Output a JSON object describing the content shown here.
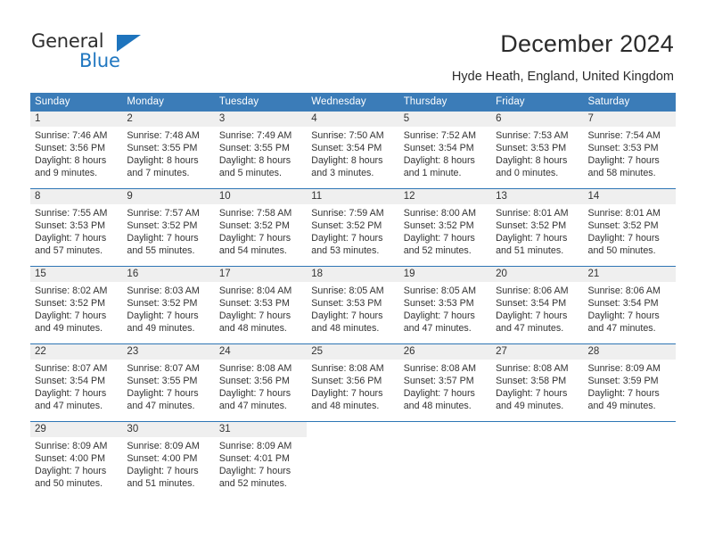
{
  "brand": {
    "name_top": "General",
    "name_bottom": "Blue",
    "accent_color": "#1e74bd",
    "triangle_icon": "triangle-icon"
  },
  "header": {
    "title": "December 2024",
    "subtitle": "Hyde Heath, England, United Kingdom"
  },
  "calendar": {
    "header_bg": "#3b7cb8",
    "row_border_color": "#2e76b5",
    "daynum_bg": "#efefef",
    "weekdays": [
      "Sunday",
      "Monday",
      "Tuesday",
      "Wednesday",
      "Thursday",
      "Friday",
      "Saturday"
    ],
    "weeks": [
      [
        {
          "day": "1",
          "lines": [
            "Sunrise: 7:46 AM",
            "Sunset: 3:56 PM",
            "Daylight: 8 hours",
            "and 9 minutes."
          ]
        },
        {
          "day": "2",
          "lines": [
            "Sunrise: 7:48 AM",
            "Sunset: 3:55 PM",
            "Daylight: 8 hours",
            "and 7 minutes."
          ]
        },
        {
          "day": "3",
          "lines": [
            "Sunrise: 7:49 AM",
            "Sunset: 3:55 PM",
            "Daylight: 8 hours",
            "and 5 minutes."
          ]
        },
        {
          "day": "4",
          "lines": [
            "Sunrise: 7:50 AM",
            "Sunset: 3:54 PM",
            "Daylight: 8 hours",
            "and 3 minutes."
          ]
        },
        {
          "day": "5",
          "lines": [
            "Sunrise: 7:52 AM",
            "Sunset: 3:54 PM",
            "Daylight: 8 hours",
            "and 1 minute."
          ]
        },
        {
          "day": "6",
          "lines": [
            "Sunrise: 7:53 AM",
            "Sunset: 3:53 PM",
            "Daylight: 8 hours",
            "and 0 minutes."
          ]
        },
        {
          "day": "7",
          "lines": [
            "Sunrise: 7:54 AM",
            "Sunset: 3:53 PM",
            "Daylight: 7 hours",
            "and 58 minutes."
          ]
        }
      ],
      [
        {
          "day": "8",
          "lines": [
            "Sunrise: 7:55 AM",
            "Sunset: 3:53 PM",
            "Daylight: 7 hours",
            "and 57 minutes."
          ]
        },
        {
          "day": "9",
          "lines": [
            "Sunrise: 7:57 AM",
            "Sunset: 3:52 PM",
            "Daylight: 7 hours",
            "and 55 minutes."
          ]
        },
        {
          "day": "10",
          "lines": [
            "Sunrise: 7:58 AM",
            "Sunset: 3:52 PM",
            "Daylight: 7 hours",
            "and 54 minutes."
          ]
        },
        {
          "day": "11",
          "lines": [
            "Sunrise: 7:59 AM",
            "Sunset: 3:52 PM",
            "Daylight: 7 hours",
            "and 53 minutes."
          ]
        },
        {
          "day": "12",
          "lines": [
            "Sunrise: 8:00 AM",
            "Sunset: 3:52 PM",
            "Daylight: 7 hours",
            "and 52 minutes."
          ]
        },
        {
          "day": "13",
          "lines": [
            "Sunrise: 8:01 AM",
            "Sunset: 3:52 PM",
            "Daylight: 7 hours",
            "and 51 minutes."
          ]
        },
        {
          "day": "14",
          "lines": [
            "Sunrise: 8:01 AM",
            "Sunset: 3:52 PM",
            "Daylight: 7 hours",
            "and 50 minutes."
          ]
        }
      ],
      [
        {
          "day": "15",
          "lines": [
            "Sunrise: 8:02 AM",
            "Sunset: 3:52 PM",
            "Daylight: 7 hours",
            "and 49 minutes."
          ]
        },
        {
          "day": "16",
          "lines": [
            "Sunrise: 8:03 AM",
            "Sunset: 3:52 PM",
            "Daylight: 7 hours",
            "and 49 minutes."
          ]
        },
        {
          "day": "17",
          "lines": [
            "Sunrise: 8:04 AM",
            "Sunset: 3:53 PM",
            "Daylight: 7 hours",
            "and 48 minutes."
          ]
        },
        {
          "day": "18",
          "lines": [
            "Sunrise: 8:05 AM",
            "Sunset: 3:53 PM",
            "Daylight: 7 hours",
            "and 48 minutes."
          ]
        },
        {
          "day": "19",
          "lines": [
            "Sunrise: 8:05 AM",
            "Sunset: 3:53 PM",
            "Daylight: 7 hours",
            "and 47 minutes."
          ]
        },
        {
          "day": "20",
          "lines": [
            "Sunrise: 8:06 AM",
            "Sunset: 3:54 PM",
            "Daylight: 7 hours",
            "and 47 minutes."
          ]
        },
        {
          "day": "21",
          "lines": [
            "Sunrise: 8:06 AM",
            "Sunset: 3:54 PM",
            "Daylight: 7 hours",
            "and 47 minutes."
          ]
        }
      ],
      [
        {
          "day": "22",
          "lines": [
            "Sunrise: 8:07 AM",
            "Sunset: 3:54 PM",
            "Daylight: 7 hours",
            "and 47 minutes."
          ]
        },
        {
          "day": "23",
          "lines": [
            "Sunrise: 8:07 AM",
            "Sunset: 3:55 PM",
            "Daylight: 7 hours",
            "and 47 minutes."
          ]
        },
        {
          "day": "24",
          "lines": [
            "Sunrise: 8:08 AM",
            "Sunset: 3:56 PM",
            "Daylight: 7 hours",
            "and 47 minutes."
          ]
        },
        {
          "day": "25",
          "lines": [
            "Sunrise: 8:08 AM",
            "Sunset: 3:56 PM",
            "Daylight: 7 hours",
            "and 48 minutes."
          ]
        },
        {
          "day": "26",
          "lines": [
            "Sunrise: 8:08 AM",
            "Sunset: 3:57 PM",
            "Daylight: 7 hours",
            "and 48 minutes."
          ]
        },
        {
          "day": "27",
          "lines": [
            "Sunrise: 8:08 AM",
            "Sunset: 3:58 PM",
            "Daylight: 7 hours",
            "and 49 minutes."
          ]
        },
        {
          "day": "28",
          "lines": [
            "Sunrise: 8:09 AM",
            "Sunset: 3:59 PM",
            "Daylight: 7 hours",
            "and 49 minutes."
          ]
        }
      ],
      [
        {
          "day": "29",
          "lines": [
            "Sunrise: 8:09 AM",
            "Sunset: 4:00 PM",
            "Daylight: 7 hours",
            "and 50 minutes."
          ]
        },
        {
          "day": "30",
          "lines": [
            "Sunrise: 8:09 AM",
            "Sunset: 4:00 PM",
            "Daylight: 7 hours",
            "and 51 minutes."
          ]
        },
        {
          "day": "31",
          "lines": [
            "Sunrise: 8:09 AM",
            "Sunset: 4:01 PM",
            "Daylight: 7 hours",
            "and 52 minutes."
          ]
        },
        {
          "day": "",
          "lines": []
        },
        {
          "day": "",
          "lines": []
        },
        {
          "day": "",
          "lines": []
        },
        {
          "day": "",
          "lines": []
        }
      ]
    ]
  }
}
